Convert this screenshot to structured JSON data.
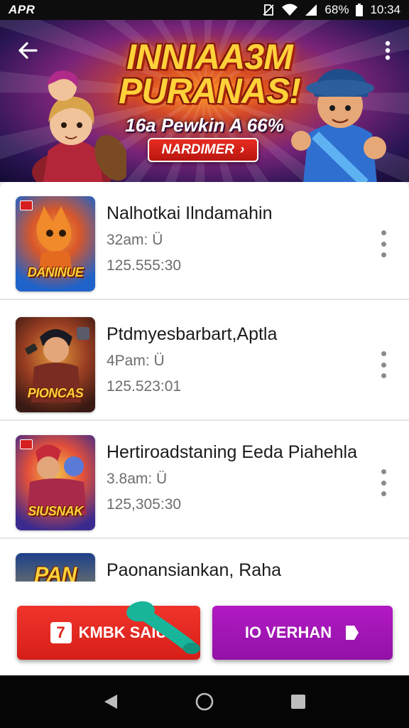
{
  "status_bar": {
    "app_label": "APR",
    "battery": "68%",
    "time": "10:34"
  },
  "hero": {
    "title_line1": "INNIAA3M",
    "title_line2": "PURANAS!",
    "subtitle": "16a Pewkin A 66%",
    "cta_label": "NARDIMER",
    "cta_arrow": "›"
  },
  "games": [
    {
      "title": "Nalhotkai Ilndamahin",
      "meta": "32am: Ü",
      "stats": "125.555:30",
      "thumb_label": "DANINUE",
      "colors": [
        "#1f62c9",
        "#f3a13a"
      ]
    },
    {
      "title": "Ptdmyesbarbart,Aptla",
      "meta": "4Pam: Ü",
      "stats": "125.523:01",
      "thumb_label": "PIONCAS",
      "colors": [
        "#6b2f1d",
        "#e29a3b"
      ]
    },
    {
      "title": "Hertiroadstaning Eeda Piahehla",
      "meta": "3.8am: Ü",
      "stats": "125,305:30",
      "thumb_label": "SIUSNAK",
      "colors": [
        "#3a2a8f",
        "#e3503a"
      ]
    },
    {
      "title": "Paonansiankan, Raha",
      "meta": "",
      "stats": "",
      "thumb_label": "PAN",
      "colors": [
        "#1c3f8a",
        "#f0c53a"
      ]
    }
  ],
  "actions": {
    "primary_label": "KMBK SAIU",
    "primary_tag": "7",
    "secondary_label": "IO VERHAN"
  },
  "colors": {
    "primary_button": "#e02a22",
    "secondary_button": "#a216b6",
    "handle": "#19b59a"
  }
}
